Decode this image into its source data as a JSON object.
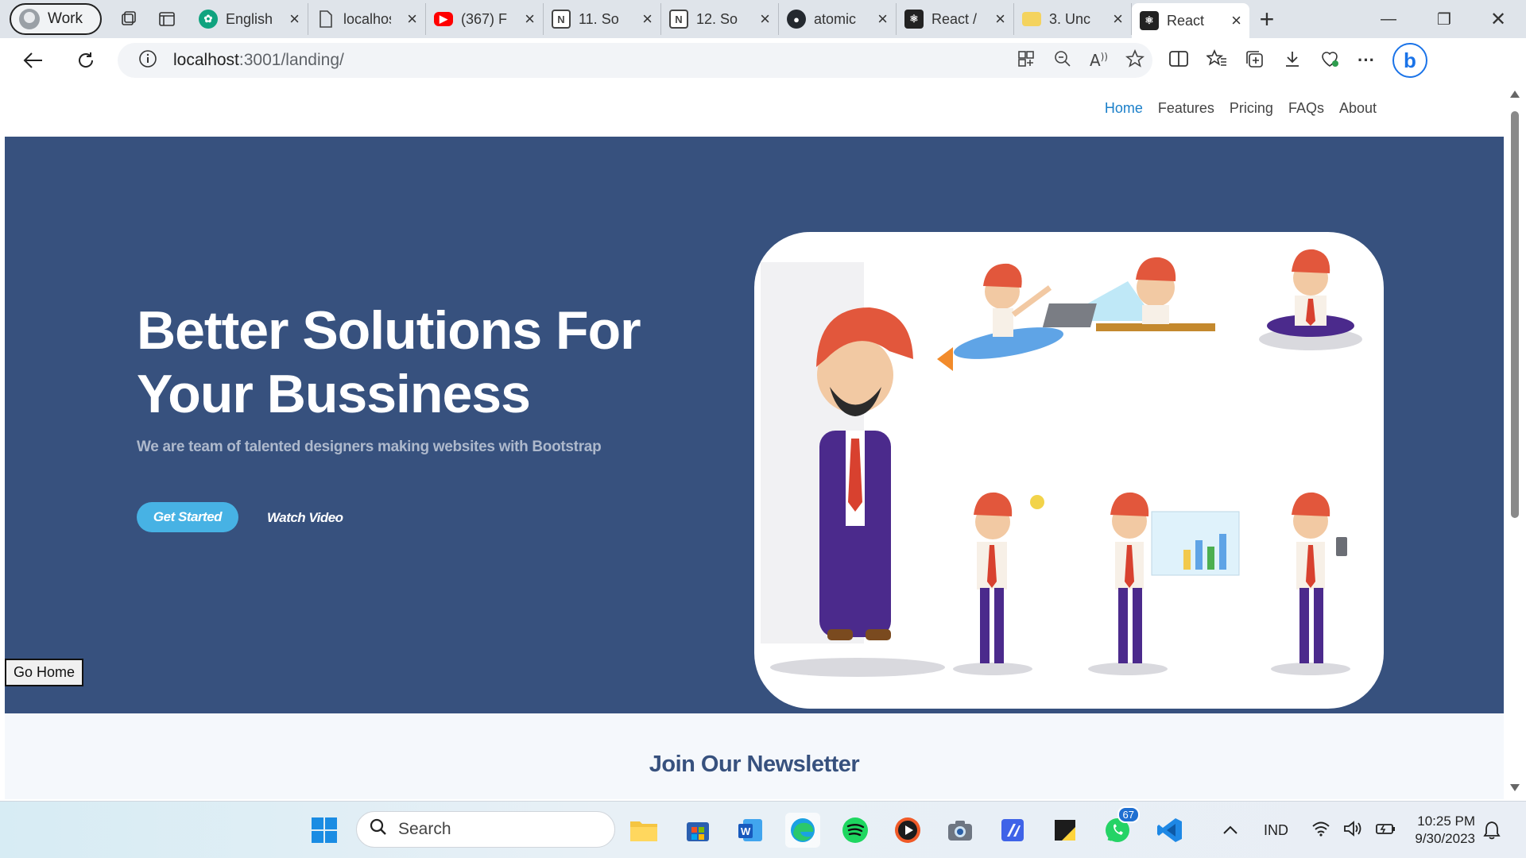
{
  "browser": {
    "profile_label": "Work",
    "tabs": [
      {
        "title": "English",
        "icon": "chatgpt-icon",
        "color": "#10a37f"
      },
      {
        "title": "localhost",
        "icon": "page-icon",
        "color": "#5f6368"
      },
      {
        "title": "(367) F",
        "icon": "youtube-icon",
        "color": "#ff0000"
      },
      {
        "title": "11. So",
        "icon": "notion-icon",
        "color": "#333333"
      },
      {
        "title": "12. So",
        "icon": "notion-icon",
        "color": "#333333"
      },
      {
        "title": "atomic",
        "icon": "github-icon",
        "color": "#24292f"
      },
      {
        "title": "React /",
        "icon": "react-icon",
        "color": "#222222"
      },
      {
        "title": "3. Unc",
        "icon": "note-icon",
        "color": "#f4d35e"
      },
      {
        "title": "React",
        "icon": "react-icon",
        "color": "#222222",
        "active": true
      }
    ],
    "url_host": "localhost",
    "url_rest": ":3001/landing/"
  },
  "site": {
    "nav": [
      {
        "label": "Home",
        "active": true
      },
      {
        "label": "Features"
      },
      {
        "label": "Pricing"
      },
      {
        "label": "FAQs"
      },
      {
        "label": "About"
      }
    ],
    "hero": {
      "title": "Better Solutions For Your Bussiness",
      "subtitle": "We are team of talented designers making websites with Bootstrap",
      "cta_primary": "Get Started",
      "cta_secondary": "Watch Video",
      "illustration": "cartoon-businessman-poses"
    },
    "go_home": "Go Home",
    "newsletter_title": "Join Our Newsletter"
  },
  "taskbar": {
    "search_placeholder": "Search",
    "apps": [
      "windows-start-icon",
      "file-explorer-icon",
      "microsoft-store-icon",
      "word-icon",
      "edge-icon",
      "spotify-icon",
      "media-player-icon",
      "camera-icon",
      "vs-code-insiders-icon",
      "sticky-notes-icon",
      "whatsapp-icon",
      "vs-code-icon"
    ],
    "whatsapp_badge": "67",
    "language": "IND",
    "time": "10:25 PM",
    "date": "9/30/2023"
  },
  "colors": {
    "hero_bg": "#37517e",
    "accent": "#47b2e4",
    "nav_active": "#1a7fc9"
  }
}
